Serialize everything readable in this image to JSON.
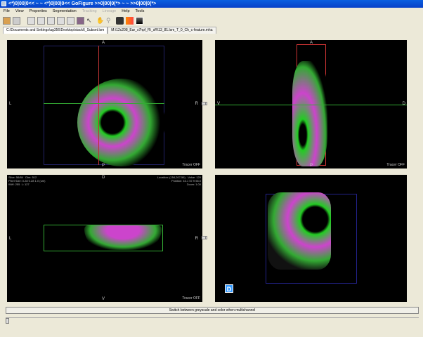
{
  "window": {
    "title": "<*)0|00|0<< ~ ~ <*)0|00|0<<     GoFigure     >>0|00|0(*> ~ ~ >>0|00|0(*>"
  },
  "menu": [
    {
      "label": "File",
      "enabled": true
    },
    {
      "label": "View",
      "enabled": true
    },
    {
      "label": "Properties",
      "enabled": true
    },
    {
      "label": "Segmentation",
      "enabled": true
    },
    {
      "label": "Tracking",
      "enabled": false
    },
    {
      "label": "Lineage",
      "enabled": false
    },
    {
      "label": "Help",
      "enabled": true
    },
    {
      "label": "Tools",
      "enabled": true
    }
  ],
  "toolbar": [
    "open-icon",
    "save-icon",
    "quad-view-icon",
    "xy-view-icon",
    "xz-view-icon",
    "yz-view-icon",
    "3d-view-icon",
    "snapshot-icon",
    "pointer-icon",
    "pan-icon",
    "zoom-icon",
    "camera-icon",
    "color-icon",
    "greyscale-icon"
  ],
  "tabs": [
    {
      "label": "C:\\Documents and Settings\\ag356\\Desktop\\stack6_Subset.lsm",
      "active": true
    },
    {
      "label": "M:\\12c208_Ear_s7hpf_R\\_sR\\13_81.lsm_T_0_Ch_c-feature.mha",
      "active": false
    }
  ],
  "views": {
    "xy": {
      "top": "A",
      "bottom": "P",
      "left": "L",
      "right": "R",
      "status": "Tracer OFF"
    },
    "yz": {
      "top": "A",
      "bottom": "P",
      "left": "V",
      "right": "D",
      "status": "Tracer OFF"
    },
    "xz": {
      "top": "D",
      "bottom": "V",
      "left": "L",
      "right": "R",
      "status": "Tracer OFF",
      "info_left": "Slice: 56/84   Dim: 512\nPixel Size: 0.28 0.28 1.0 (um)\nWW: 255  L: 127",
      "info_right": "Location: (154,207,56)   Value: 120\nPosition: 43.1 57.9 56.0\nZoom: 1.00"
    },
    "volume": {
      "badge": "D"
    }
  },
  "bottom": {
    "switch_button": "Switch between greyscale and color when multichannel"
  }
}
